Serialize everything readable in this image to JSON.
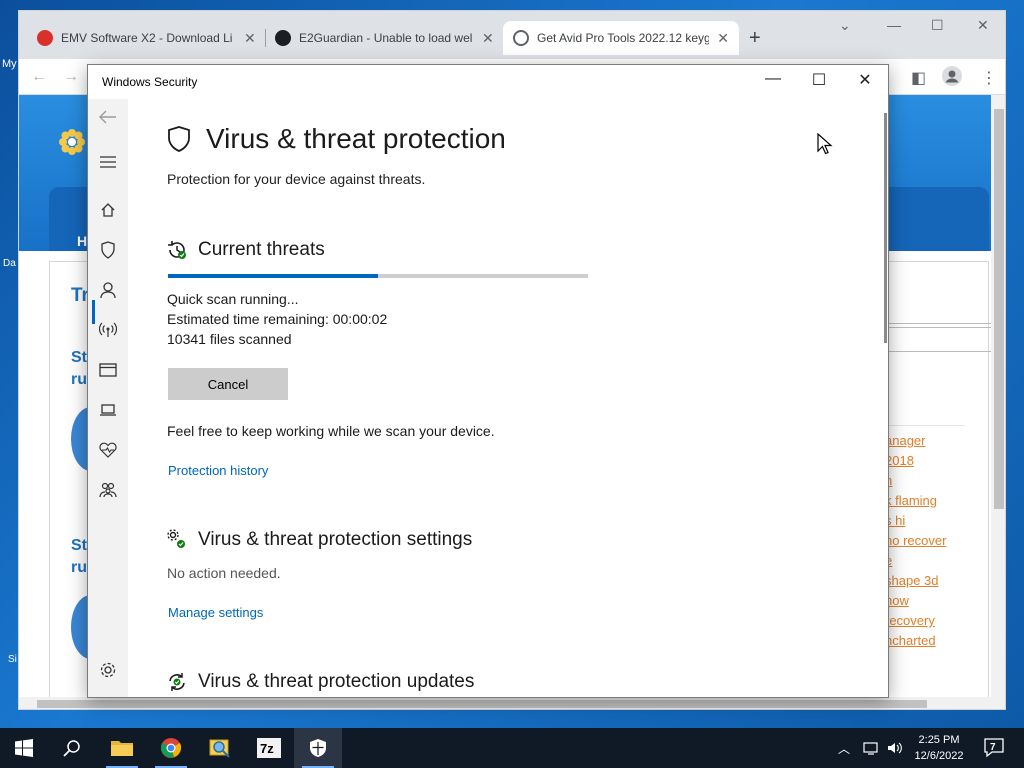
{
  "desktop": {
    "fragments": [
      "My",
      "Da",
      "Si"
    ]
  },
  "browser": {
    "tabs": [
      {
        "title": "EMV Software X2 - Download Li",
        "icon": "app-icon"
      },
      {
        "title": "E2Guardian - Unable to load wel",
        "icon": "github-icon"
      },
      {
        "title": "Get Avid Pro Tools 2022.12 keyg",
        "icon": "globe-icon"
      }
    ],
    "page": {
      "heading_fragments": [
        "H",
        "Tr",
        "Ste",
        "ru",
        "Ste",
        "ru"
      ],
      "links": [
        "anager",
        "2018",
        "n",
        "k  flaming",
        "s  hi",
        "no recover",
        "e",
        "shape 3d",
        "how",
        "recovery",
        "ncharted"
      ]
    }
  },
  "security": {
    "window_title": "Windows Security",
    "heading": "Virus & threat protection",
    "subtitle": "Protection for your device against threats.",
    "current_threats": {
      "heading": "Current threats",
      "progress_percent": 50,
      "status": "Quick scan running...",
      "time_remaining": "Estimated time remaining:  00:00:02",
      "files_scanned": "10341  files scanned",
      "cancel_label": "Cancel",
      "keep_working": "Feel free to keep working while we scan your device.",
      "history_link": "Protection history"
    },
    "settings": {
      "heading": "Virus & threat protection settings",
      "status": "No action needed.",
      "manage_link": "Manage settings"
    },
    "updates": {
      "heading": "Virus & threat protection updates"
    }
  },
  "taskbar": {
    "time": "2:25 PM",
    "date": "12/6/2022",
    "notification_count": "7"
  }
}
